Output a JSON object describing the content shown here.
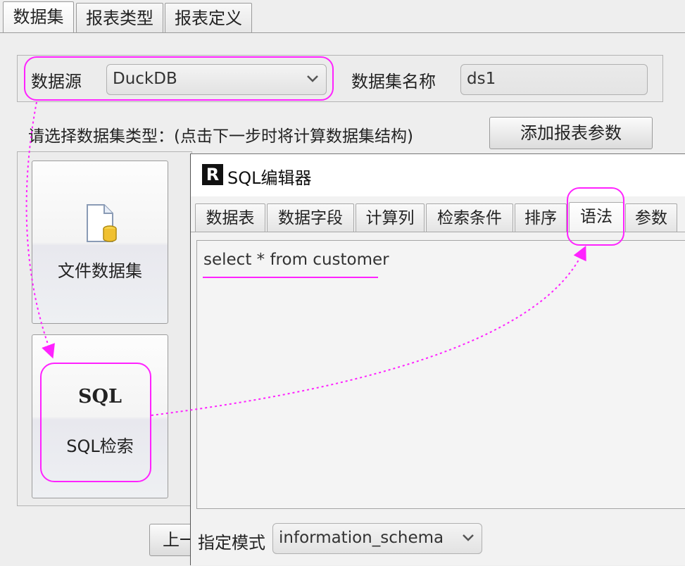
{
  "top_tabs": [
    {
      "label": "数据集",
      "active": true
    },
    {
      "label": "报表类型",
      "active": false
    },
    {
      "label": "报表定义",
      "active": false
    }
  ],
  "datasource": {
    "label": "数据源",
    "value": "DuckDB",
    "name_label": "数据集名称",
    "name_value": "ds1"
  },
  "prompt": "请选择数据集类型：(点击下一步时将计算数据集结构)",
  "add_param_button": "添加报表参数",
  "dataset_types": [
    {
      "label": "文件数据集",
      "icon": "file-database-icon"
    },
    {
      "label": "SQL检索",
      "icon": "sql-icon",
      "icon_text": "SQL"
    }
  ],
  "prev_button_partial": "上一",
  "sql_editor": {
    "title": "SQL编辑器",
    "icon_letter": "R",
    "tabs": [
      {
        "label": "数据表",
        "active": false
      },
      {
        "label": "数据字段",
        "active": false
      },
      {
        "label": "计算列",
        "active": false
      },
      {
        "label": "检索条件",
        "active": false
      },
      {
        "label": "排序",
        "active": false
      },
      {
        "label": "语法",
        "active": true
      },
      {
        "label": "参数",
        "active": false
      }
    ],
    "sql_text": "select * from customer",
    "schema_label": "指定模式",
    "schema_value": "information_schema"
  },
  "annotation_color": "#ff22ff"
}
